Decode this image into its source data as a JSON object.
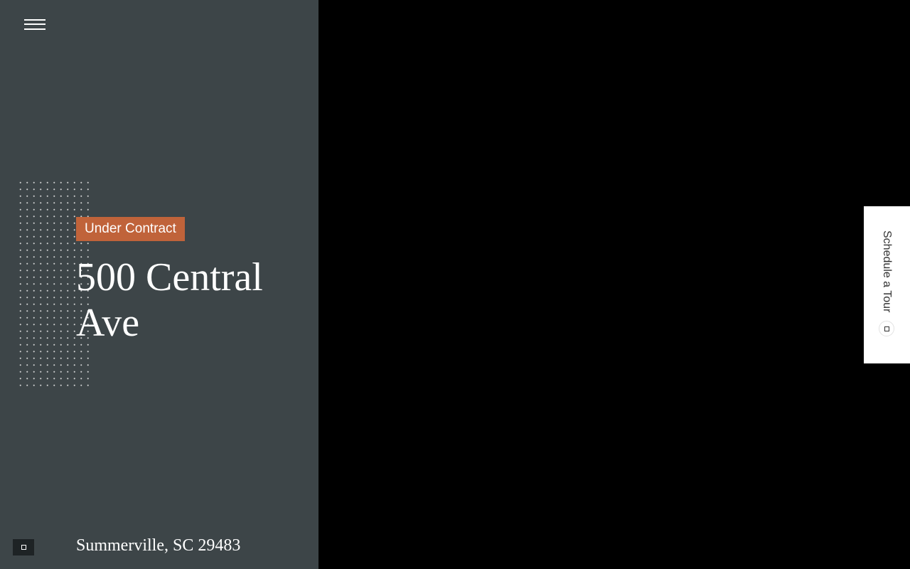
{
  "header": {
    "menu_icon": "hamburger-menu-icon"
  },
  "listing": {
    "status": "Under Contract",
    "address": "500 Central Ave",
    "location": "Summerville, SC 29483"
  },
  "schedule_tab": {
    "label": "Schedule a Tour",
    "icon": "calendar-icon"
  },
  "footer": {
    "action_icon": "expand-icon"
  },
  "colors": {
    "panel_background": "#3d4548",
    "status_badge": "#c0633a",
    "media_area": "#000000",
    "tab_background": "#ffffff"
  }
}
